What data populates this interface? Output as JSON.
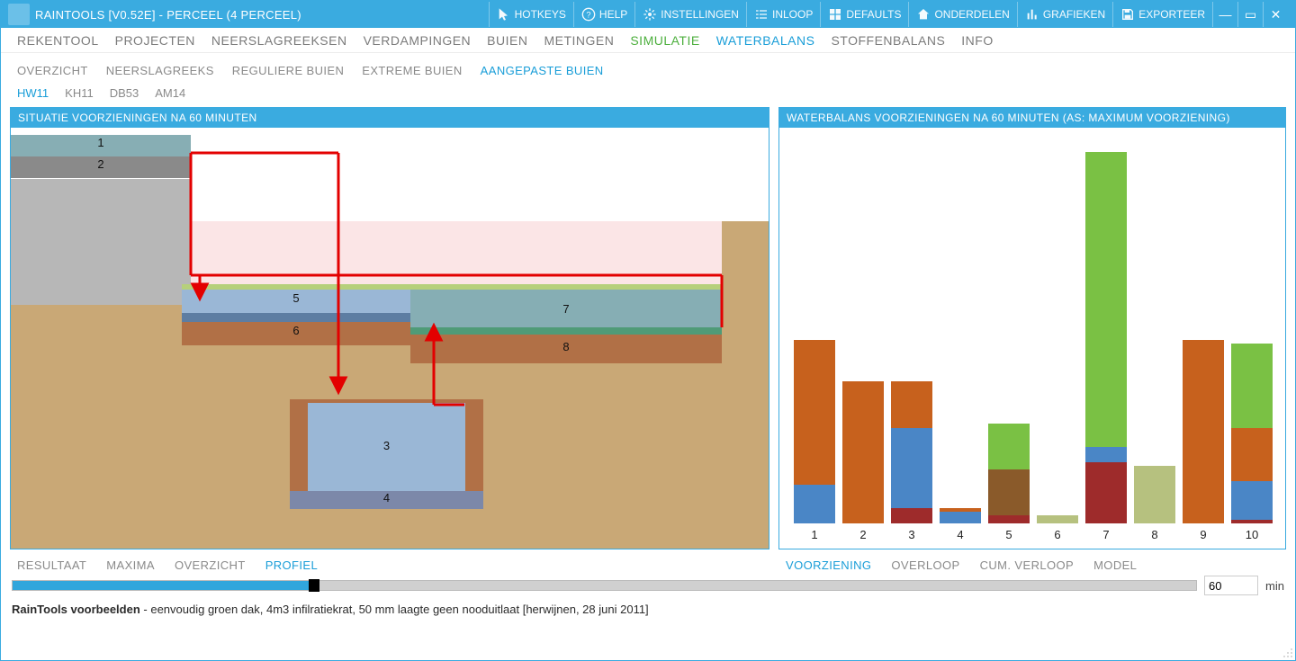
{
  "titlebar": {
    "app_title": "RAINTOOLS [V0.52E] - PERCEEL (4 PERCEEL)",
    "buttons": {
      "hotkeys": "HOTKEYS",
      "help": "HELP",
      "instellingen": "INSTELLINGEN",
      "inloop": "INLOOP",
      "defaults": "DEFAULTS",
      "onderdelen": "ONDERDELEN",
      "grafieken": "GRAFIEKEN",
      "exporteer": "EXPORTEER"
    }
  },
  "menubar": {
    "items": [
      "REKENTOOL",
      "PROJECTEN",
      "NEERSLAGREEKSEN",
      "VERDAMPINGEN",
      "BUIEN",
      "METINGEN",
      "SIMULATIE",
      "WATERBALANS",
      "STOFFENBALANS",
      "INFO"
    ],
    "active_green_index": 6,
    "active_blue_index": 7
  },
  "subtabs": {
    "items": [
      "OVERZICHT",
      "NEERSLAGREEKS",
      "REGULIERE BUIEN",
      "EXTREME BUIEN",
      "AANGEPASTE BUIEN"
    ],
    "active_index": 4
  },
  "subtabs2": {
    "items": [
      "HW11",
      "KH11",
      "DB53",
      "AM14"
    ],
    "active_index": 0
  },
  "left_panel": {
    "title": "SITUATIE VOORZIENINGEN NA 60 MINUTEN",
    "labels": {
      "l1": "1",
      "l2": "2",
      "l3": "3",
      "l4": "4",
      "l5": "5",
      "l6": "6",
      "l7": "7",
      "l8": "8"
    }
  },
  "right_panel": {
    "title": "WATERBALANS VOORZIENINGEN NA 60 MINUTEN (AS: MAXIMUM VOORZIENING)"
  },
  "bottom_tabs_left": {
    "items": [
      "RESULTAAT",
      "MAXIMA",
      "OVERZICHT",
      "PROFIEL"
    ],
    "active_index": 3
  },
  "bottom_tabs_right": {
    "items": [
      "VOORZIENING",
      "OVERLOOP",
      "CUM. VERLOOP",
      "MODEL"
    ],
    "active_index": 0
  },
  "slider": {
    "value": "60",
    "unit": "min"
  },
  "footer": {
    "bold": "RainTools voorbeelden",
    "rest": " - eenvoudig groen dak, 4m3 infilratiekrat, 50 mm laagte geen nooduitlaat [herwijnen, 28 juni 2011]"
  },
  "chart_data": {
    "type": "bar",
    "title": "WATERBALANS VOORZIENINGEN NA 60 MINUTEN (AS: MAXIMUM VOORZIENING)",
    "xlabel": "",
    "ylabel": "",
    "ylim": [
      0,
      100
    ],
    "categories": [
      "1",
      "2",
      "3",
      "4",
      "5",
      "6",
      "7",
      "8",
      "9",
      "10"
    ],
    "colors": {
      "blue": "#4a86c6",
      "orange": "#c7611d",
      "darkred": "#9e2b2b",
      "brown": "#8a5a2a",
      "green": "#7ac144",
      "olive": "#b6c17f"
    },
    "series_note": "stacked, proportion of maximum (visual estimate)",
    "bars": [
      {
        "cat": "1",
        "segments": [
          {
            "color": "blue",
            "h": 10
          },
          {
            "color": "orange",
            "h": 38
          }
        ]
      },
      {
        "cat": "2",
        "segments": [
          {
            "color": "orange",
            "h": 37
          }
        ]
      },
      {
        "cat": "3",
        "segments": [
          {
            "color": "darkred",
            "h": 4
          },
          {
            "color": "blue",
            "h": 21
          },
          {
            "color": "orange",
            "h": 12
          }
        ]
      },
      {
        "cat": "4",
        "segments": [
          {
            "color": "blue",
            "h": 3
          },
          {
            "color": "orange",
            "h": 1
          }
        ]
      },
      {
        "cat": "5",
        "segments": [
          {
            "color": "darkred",
            "h": 2
          },
          {
            "color": "brown",
            "h": 12
          },
          {
            "color": "green",
            "h": 12
          }
        ]
      },
      {
        "cat": "6",
        "segments": [
          {
            "color": "olive",
            "h": 2
          }
        ]
      },
      {
        "cat": "7",
        "segments": [
          {
            "color": "darkred",
            "h": 16
          },
          {
            "color": "blue",
            "h": 4
          },
          {
            "color": "green",
            "h": 77
          }
        ]
      },
      {
        "cat": "8",
        "segments": [
          {
            "color": "olive",
            "h": 15
          }
        ]
      },
      {
        "cat": "9",
        "segments": [
          {
            "color": "orange",
            "h": 48
          }
        ]
      },
      {
        "cat": "10",
        "segments": [
          {
            "color": "darkred",
            "h": 1
          },
          {
            "color": "blue",
            "h": 10
          },
          {
            "color": "orange",
            "h": 14
          },
          {
            "color": "green",
            "h": 22
          }
        ]
      }
    ]
  }
}
